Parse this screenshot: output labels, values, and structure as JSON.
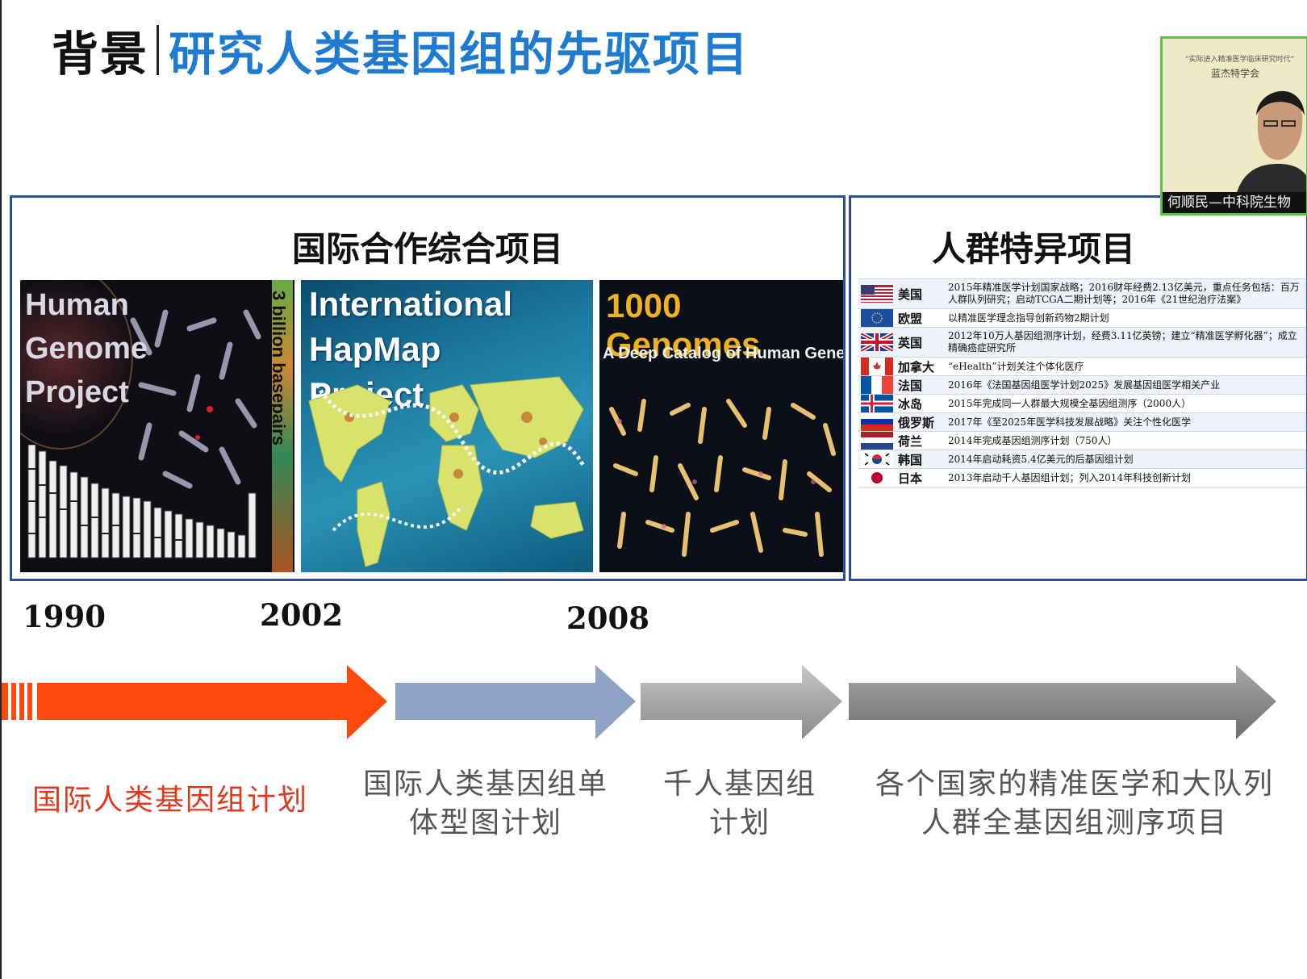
{
  "slide": {
    "title_main": "背景",
    "title_sub": "研究人类基因组的先驱项目"
  },
  "left_panel": {
    "title": "国际合作综合项目",
    "hgp": {
      "title_lines": [
        "Human",
        "Genome",
        "Project"
      ],
      "side_text": "3 billion basepairs"
    },
    "hapmap": {
      "title_lines": [
        "International",
        "HapMap",
        "Project"
      ]
    },
    "g1000": {
      "title": "1000 Genomes",
      "subtitle": "A Deep Catalog of Human Genetic Variation"
    }
  },
  "right_panel": {
    "title": "人群特异项目",
    "countries": [
      {
        "name": "美国",
        "flag": "usa-flag-icon",
        "desc": "2015年精准医学计划国家战略；2016财年经费2.13亿美元，重点任务包括：百万人群队列研究；启动TCGA二期计划等；2016年《21世纪治疗法案》"
      },
      {
        "name": "欧盟",
        "flag": "eu-flag-icon",
        "desc": "以精准医学理念指导创新药物2期计划"
      },
      {
        "name": "英国",
        "flag": "uk-flag-icon",
        "desc": "2012年10万人基因组测序计划，经费3.11亿英镑；建立“精准医学孵化器”；成立精确癌症研究所"
      },
      {
        "name": "加拿大",
        "flag": "canada-flag-icon",
        "desc": "“eHealth”计划关注个体化医疗"
      },
      {
        "name": "法国",
        "flag": "france-flag-icon",
        "desc": "2016年《法国基因组医学计划2025》发展基因组医学相关产业"
      },
      {
        "name": "冰岛",
        "flag": "iceland-flag-icon",
        "desc": "2015年完成同一人群最大规模全基因组测序（2000人）"
      },
      {
        "name": "俄罗斯",
        "flag": "russia-flag-icon",
        "desc": "2017年《至2025年医学科技发展战略》关注个性化医学"
      },
      {
        "name": "荷兰",
        "flag": "netherlands-flag-icon",
        "desc": "2014年完成基因组测序计划（750人）"
      },
      {
        "name": "韩国",
        "flag": "korea-flag-icon",
        "desc": "2014年启动耗资5.4亿美元的后基因组计划"
      },
      {
        "name": "日本",
        "flag": "japan-flag-icon",
        "desc": "2013年启动千人基因组计划；列入2014年科技创新计划"
      }
    ]
  },
  "timeline": {
    "years": [
      "1990",
      "2002",
      "2008"
    ],
    "labels": [
      {
        "line1": "国际人类基因组计划",
        "line2": ""
      },
      {
        "line1": "国际人类基因组单",
        "line2": "体型图计划"
      },
      {
        "line1": "千人基因组",
        "line2": "计划"
      },
      {
        "line1": "各个国家的精准医学和大队列",
        "line2": "人群全基因组测序项目"
      }
    ],
    "colors": {
      "hgp": "#ff4a0e",
      "hapmap": "#8fa2c4",
      "g1000": "#a9a9a9",
      "national": "#8a8a8a"
    }
  },
  "webcam": {
    "poster_line1": "“实际进入精准医学临床研究时代”",
    "poster_line2": "蓝杰特学会",
    "speaker": "何顺民—中科院生物"
  }
}
